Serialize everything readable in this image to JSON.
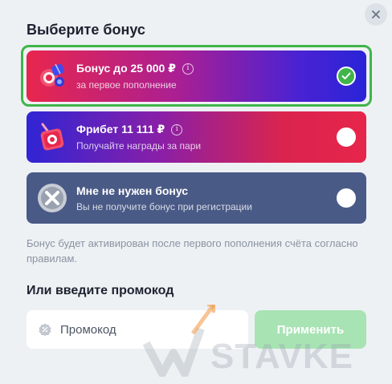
{
  "modal": {
    "title": "Выберите бонус",
    "close_icon": "close-icon"
  },
  "options": [
    {
      "title": "Бонус до 25 000 ₽",
      "subtitle": "за первое пополнение",
      "info": "i",
      "selected": true,
      "icon": "chips-gift-icon"
    },
    {
      "title": "Фрибет 11 111 ₽",
      "subtitle": "Получайте награды за пари",
      "info": "i",
      "selected": false,
      "icon": "gift-box-icon"
    },
    {
      "title": "Мне не нужен бонус",
      "subtitle": "Вы не получите бонус при регистрации",
      "selected": false,
      "icon": "no-bonus-icon"
    }
  ],
  "note": "Бонус будет активирован после первого пополнения счёта согласно правилам.",
  "promo": {
    "title": "Или введите промокод",
    "placeholder": "Промокод",
    "apply_label": "Применить"
  },
  "watermark": "STAVKE",
  "colors": {
    "accent_green": "#3fb54a",
    "apply_disabled": "#a8e3b4",
    "background": "#eef1f4",
    "card_neutral": "#4a5a86"
  }
}
